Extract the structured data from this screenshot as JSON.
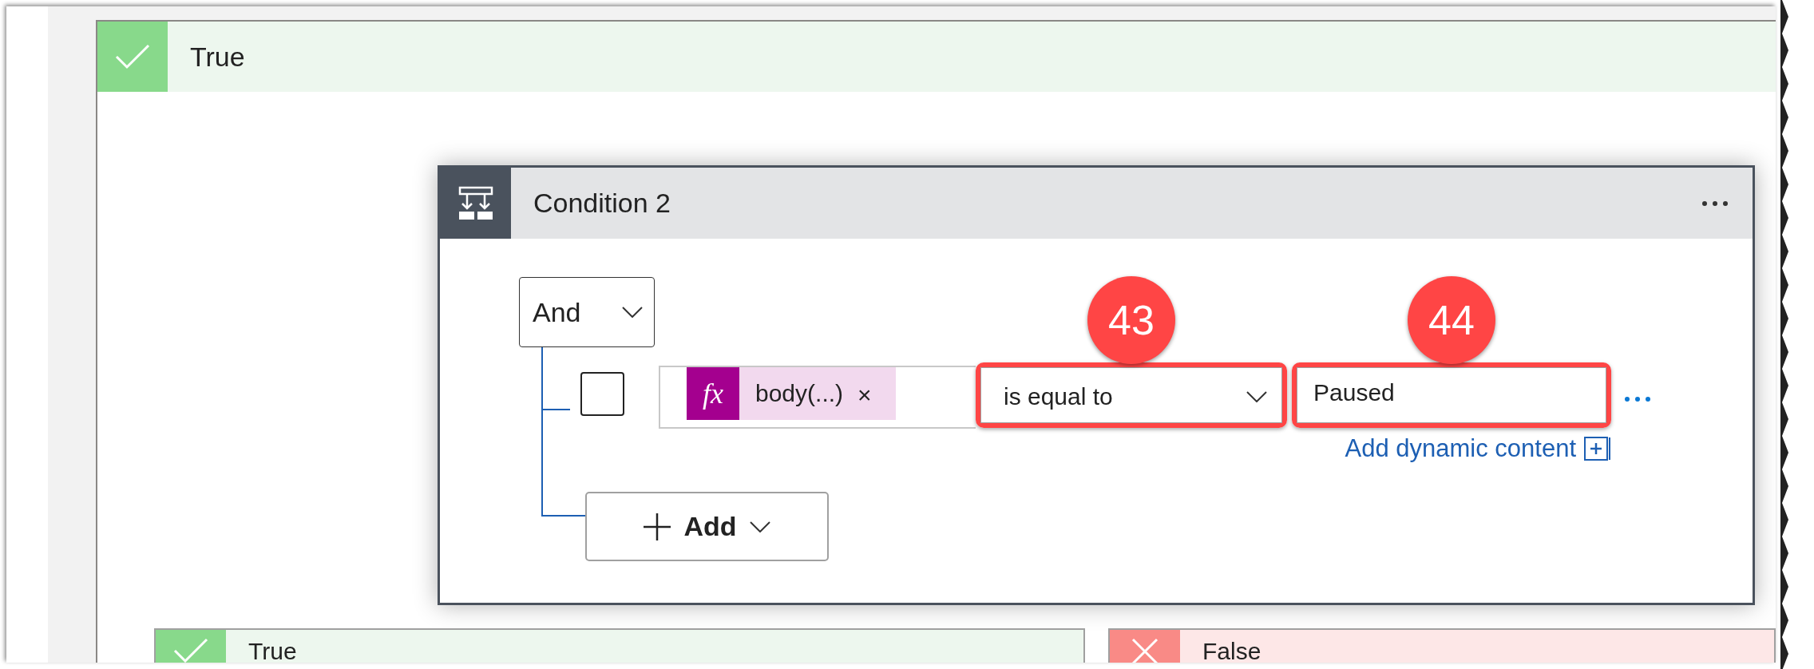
{
  "scope": {
    "label": "True",
    "kind": "true"
  },
  "condition": {
    "title": "Condition 2",
    "group_operator": "And",
    "rows": [
      {
        "checked": false,
        "operand": {
          "icon_text": "fx",
          "token": "body(...)",
          "remove": "×"
        },
        "operator": "is equal to",
        "operator_callout": "43",
        "value": "Paused",
        "value_callout": "44",
        "link": "Add dynamic content"
      }
    ],
    "add_button": "Add"
  },
  "branches": [
    {
      "label": "True",
      "kind": "true"
    },
    {
      "label": "False",
      "kind": "false"
    }
  ]
}
